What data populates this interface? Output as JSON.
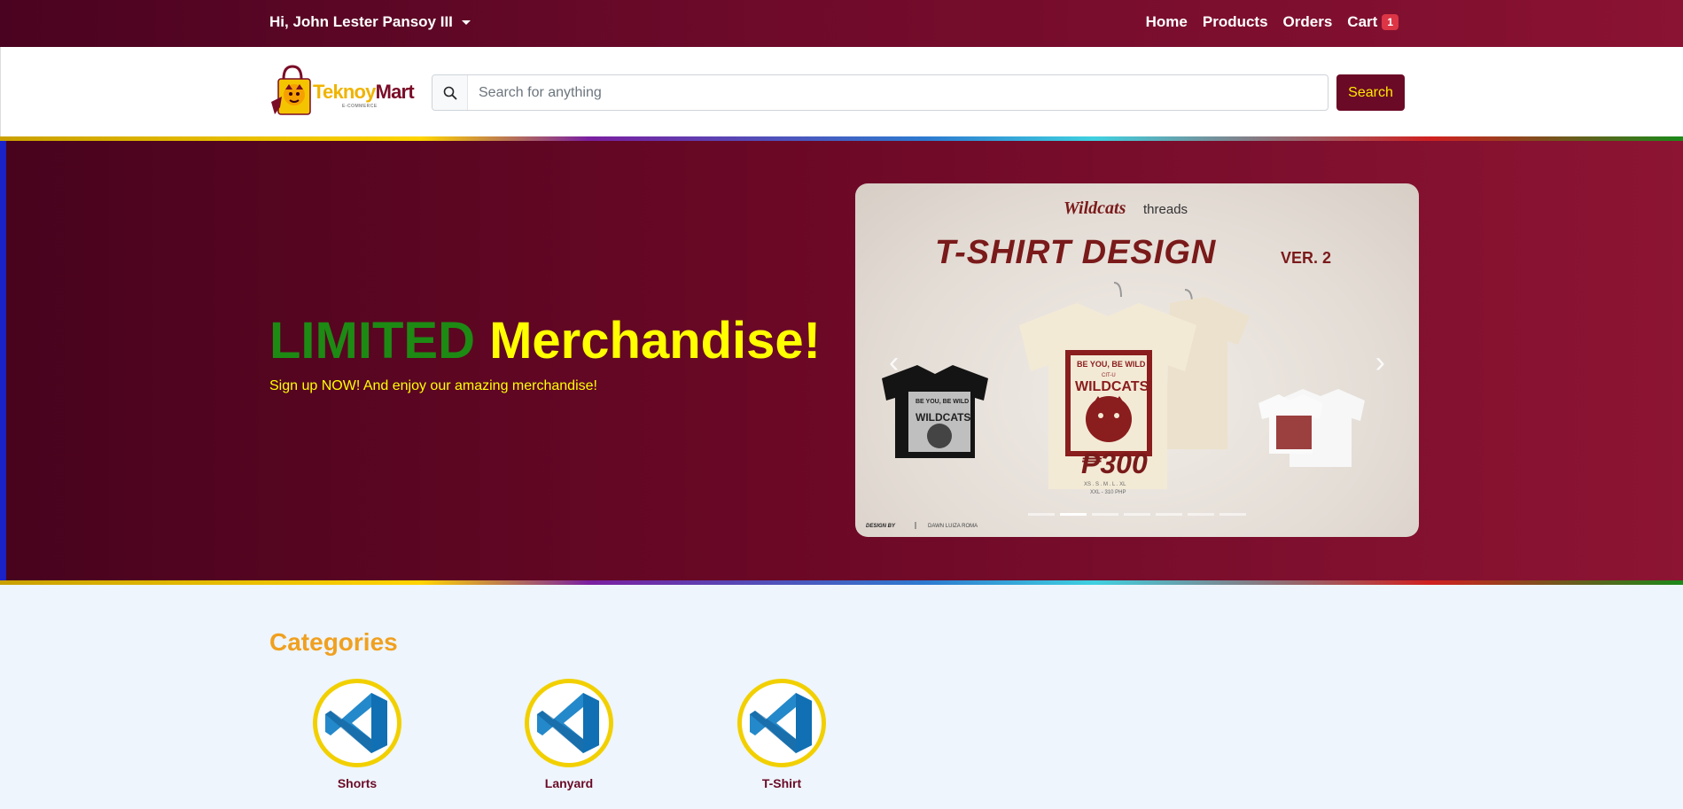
{
  "topbar": {
    "greeting": "Hi, John Lester Pansoy III",
    "nav": [
      {
        "label": "Home"
      },
      {
        "label": "Products"
      },
      {
        "label": "Orders"
      },
      {
        "label": "Cart",
        "badge": "1"
      }
    ]
  },
  "header": {
    "logo": {
      "text_part1": "Teknoy",
      "text_part2": "Mart",
      "subtitle": "E-COMMERCE"
    },
    "search": {
      "placeholder": "Search for anything",
      "value": ""
    },
    "search_button": "Search"
  },
  "hero": {
    "title_part1": "LIMITED",
    "title_part2": "Merchandise!",
    "subtitle": "Sign up NOW! And enjoy our amazing merchandise!",
    "carousel": {
      "brand_left": "Wildcats",
      "brand_right": "threads",
      "headline": "T-SHIRT DESIGN",
      "version": "VER. 2",
      "shirt_text": "BE YOU, BE WILD",
      "shirt_sub": "CIT-U",
      "shirt_name": "WILDCATS",
      "price": "₱300",
      "sizes": "XS . S . M . L . XL",
      "sizes_extra": "XXL - 310 PHP",
      "credit_label": "DESIGN BY",
      "credit_name": "DAWN LUIZA ROMA",
      "slide_count": 7,
      "active_slide": 1
    }
  },
  "categories": {
    "title": "Categories",
    "items": [
      {
        "label": "Shorts"
      },
      {
        "label": "Lanyard"
      },
      {
        "label": "T-Shirt"
      }
    ]
  },
  "colors": {
    "maroon": "#6b0a26",
    "yellow": "#ffff00",
    "green": "#1d8a14",
    "orange": "#f0a020",
    "badge_red": "#dc3545"
  }
}
